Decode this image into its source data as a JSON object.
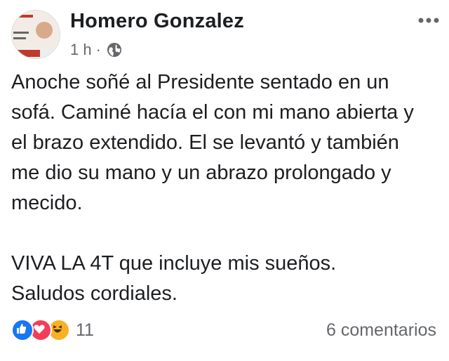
{
  "post": {
    "author": "Homero Gonzalez",
    "timestamp": "1 h",
    "separator": "·",
    "privacy_icon": "globe-icon",
    "menu_icon": "more-options-icon",
    "avatar_icon": "profile-photo",
    "body": {
      "paragraph1": "Anoche soñé al Presidente sentado en un sofá. Caminé hacía el con mi mano abierta y el brazo extendido. El se levantó y también me dio su mano y un abrazo prolongado y mecido.",
      "paragraph2_line1": "VIVA LA 4T que incluye mis sueños.",
      "paragraph2_line2": "Saludos cordiales."
    },
    "reactions": {
      "icons": [
        "like-icon",
        "love-icon",
        "haha-icon"
      ],
      "count": "11"
    },
    "comments_label": "6 comentarios"
  },
  "colors": {
    "like": "#1877f2",
    "love": "#f33e58",
    "haha": "#f7b125",
    "secondary_text": "#65676b"
  }
}
